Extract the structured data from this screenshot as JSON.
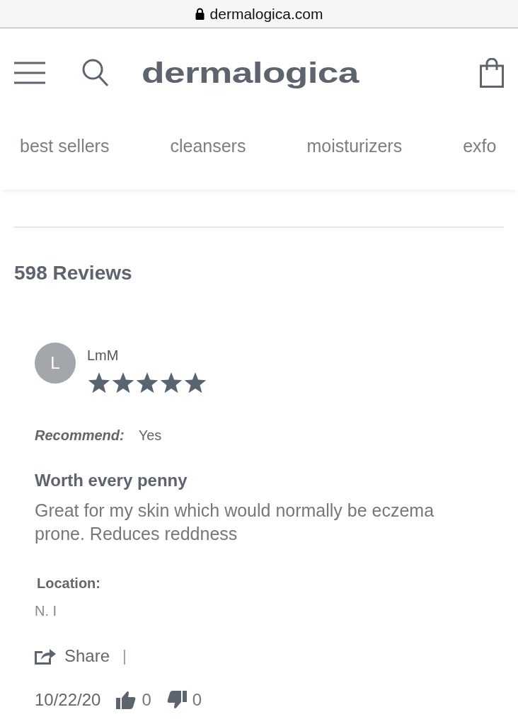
{
  "address_bar": {
    "url": "dermalogica.com"
  },
  "header": {
    "logo": "dermalogica"
  },
  "categories": [
    {
      "label": "best sellers"
    },
    {
      "label": "cleansers"
    },
    {
      "label": "moisturizers"
    },
    {
      "label": "exfo"
    }
  ],
  "reviews_heading": "598 Reviews",
  "review": {
    "avatar_letter": "L",
    "author": "LmM",
    "stars": 5,
    "recommend_label": "Recommend:",
    "recommend_value": "Yes",
    "title": "Worth every penny",
    "body": "Great for my skin which would normally be eczema prone. Reduces reddness",
    "location_label": "Location:",
    "location_value": "N. I",
    "share": "Share",
    "separator": "|",
    "date": "10/22/20",
    "helpful_count": "0",
    "unhelpful_count": "0"
  }
}
